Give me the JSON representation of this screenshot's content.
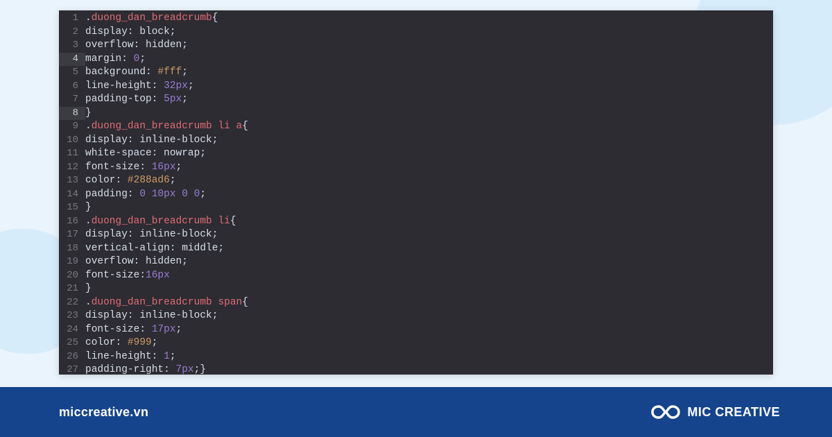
{
  "colors": {
    "background": "#eaf4fc",
    "editor_bg": "#2c2c32",
    "footer_bg": "#16448c",
    "selector": "#e06c75",
    "number": "#9b7dd4",
    "hex": "#d19a66",
    "text": "#d8dee9"
  },
  "footer": {
    "url": "miccreative.vn",
    "brand": "MIC CREATIVE"
  },
  "code": {
    "lines": [
      {
        "n": 1,
        "tokens": [
          [
            "punc",
            "."
          ],
          [
            "kclass",
            "duong_dan_breadcrumb"
          ],
          [
            "punc",
            "{"
          ]
        ]
      },
      {
        "n": 2,
        "tokens": [
          [
            "prop",
            "display"
          ],
          [
            "punc",
            ": "
          ],
          [
            "val",
            "block"
          ],
          [
            "punc",
            ";"
          ]
        ]
      },
      {
        "n": 3,
        "tokens": [
          [
            "prop",
            "overflow"
          ],
          [
            "punc",
            ": "
          ],
          [
            "val",
            "hidden"
          ],
          [
            "punc",
            ";"
          ]
        ]
      },
      {
        "n": 4,
        "tokens": [
          [
            "prop",
            "margin"
          ],
          [
            "punc",
            ": "
          ],
          [
            "num",
            "0"
          ],
          [
            "punc",
            ";"
          ]
        ],
        "active": true
      },
      {
        "n": 5,
        "tokens": [
          [
            "prop",
            "background"
          ],
          [
            "punc",
            ": "
          ],
          [
            "hex",
            "#fff"
          ],
          [
            "punc",
            ";"
          ]
        ]
      },
      {
        "n": 6,
        "tokens": [
          [
            "prop",
            "line-height"
          ],
          [
            "punc",
            ": "
          ],
          [
            "num",
            "32px"
          ],
          [
            "punc",
            ";"
          ]
        ]
      },
      {
        "n": 7,
        "tokens": [
          [
            "prop",
            "padding-top"
          ],
          [
            "punc",
            ": "
          ],
          [
            "num",
            "5px"
          ],
          [
            "punc",
            ";"
          ]
        ]
      },
      {
        "n": 8,
        "tokens": [
          [
            "punc",
            "}"
          ]
        ],
        "active": true
      },
      {
        "n": 9,
        "tokens": [
          [
            "punc",
            "."
          ],
          [
            "kclass",
            "duong_dan_breadcrumb"
          ],
          [
            "punc",
            " "
          ],
          [
            "sel",
            "li"
          ],
          [
            "punc",
            " "
          ],
          [
            "sel",
            "a"
          ],
          [
            "punc",
            "{"
          ]
        ]
      },
      {
        "n": 10,
        "tokens": [
          [
            "prop",
            "display"
          ],
          [
            "punc",
            ": "
          ],
          [
            "val",
            "inline-block"
          ],
          [
            "punc",
            ";"
          ]
        ]
      },
      {
        "n": 11,
        "tokens": [
          [
            "prop",
            "white-space"
          ],
          [
            "punc",
            ": "
          ],
          [
            "val",
            "nowrap"
          ],
          [
            "punc",
            ";"
          ]
        ]
      },
      {
        "n": 12,
        "tokens": [
          [
            "prop",
            "font-size"
          ],
          [
            "punc",
            ": "
          ],
          [
            "num",
            "16px"
          ],
          [
            "punc",
            ";"
          ]
        ]
      },
      {
        "n": 13,
        "tokens": [
          [
            "prop",
            "color"
          ],
          [
            "punc",
            ": "
          ],
          [
            "hex",
            "#288ad6"
          ],
          [
            "punc",
            ";"
          ]
        ]
      },
      {
        "n": 14,
        "tokens": [
          [
            "prop",
            "padding"
          ],
          [
            "punc",
            ": "
          ],
          [
            "num",
            "0"
          ],
          [
            "punc",
            " "
          ],
          [
            "num",
            "10px"
          ],
          [
            "punc",
            " "
          ],
          [
            "num",
            "0"
          ],
          [
            "punc",
            " "
          ],
          [
            "num",
            "0"
          ],
          [
            "punc",
            ";"
          ]
        ]
      },
      {
        "n": 15,
        "tokens": [
          [
            "punc",
            "}"
          ]
        ]
      },
      {
        "n": 16,
        "tokens": [
          [
            "punc",
            "."
          ],
          [
            "kclass",
            "duong_dan_breadcrumb"
          ],
          [
            "punc",
            " "
          ],
          [
            "sel",
            "li"
          ],
          [
            "punc",
            "{"
          ]
        ]
      },
      {
        "n": 17,
        "tokens": [
          [
            "prop",
            "display"
          ],
          [
            "punc",
            ": "
          ],
          [
            "val",
            "inline-block"
          ],
          [
            "punc",
            ";"
          ]
        ]
      },
      {
        "n": 18,
        "tokens": [
          [
            "prop",
            "vertical-align"
          ],
          [
            "punc",
            ": "
          ],
          [
            "val",
            "middle"
          ],
          [
            "punc",
            ";"
          ]
        ]
      },
      {
        "n": 19,
        "tokens": [
          [
            "prop",
            "overflow"
          ],
          [
            "punc",
            ": "
          ],
          [
            "val",
            "hidden"
          ],
          [
            "punc",
            ";"
          ]
        ]
      },
      {
        "n": 20,
        "tokens": [
          [
            "prop",
            "font-size"
          ],
          [
            "punc",
            ":"
          ],
          [
            "num",
            "16px"
          ]
        ]
      },
      {
        "n": 21,
        "tokens": [
          [
            "punc",
            "}"
          ]
        ]
      },
      {
        "n": 22,
        "tokens": [
          [
            "punc",
            "."
          ],
          [
            "kclass",
            "duong_dan_breadcrumb"
          ],
          [
            "punc",
            " "
          ],
          [
            "sel",
            "span"
          ],
          [
            "punc",
            "{"
          ]
        ]
      },
      {
        "n": 23,
        "tokens": [
          [
            "prop",
            "display"
          ],
          [
            "punc",
            ": "
          ],
          [
            "val",
            "inline-block"
          ],
          [
            "punc",
            ";"
          ]
        ]
      },
      {
        "n": 24,
        "tokens": [
          [
            "prop",
            "font-size"
          ],
          [
            "punc",
            ": "
          ],
          [
            "num",
            "17px"
          ],
          [
            "punc",
            ";"
          ]
        ]
      },
      {
        "n": 25,
        "tokens": [
          [
            "prop",
            "color"
          ],
          [
            "punc",
            ": "
          ],
          [
            "hex",
            "#999"
          ],
          [
            "punc",
            ";"
          ]
        ]
      },
      {
        "n": 26,
        "tokens": [
          [
            "prop",
            "line-height"
          ],
          [
            "punc",
            ": "
          ],
          [
            "num",
            "1"
          ],
          [
            "punc",
            ";"
          ]
        ]
      },
      {
        "n": 27,
        "tokens": [
          [
            "prop",
            "padding-right"
          ],
          [
            "punc",
            ": "
          ],
          [
            "num",
            "7px"
          ],
          [
            "punc",
            ";}"
          ]
        ]
      }
    ]
  }
}
